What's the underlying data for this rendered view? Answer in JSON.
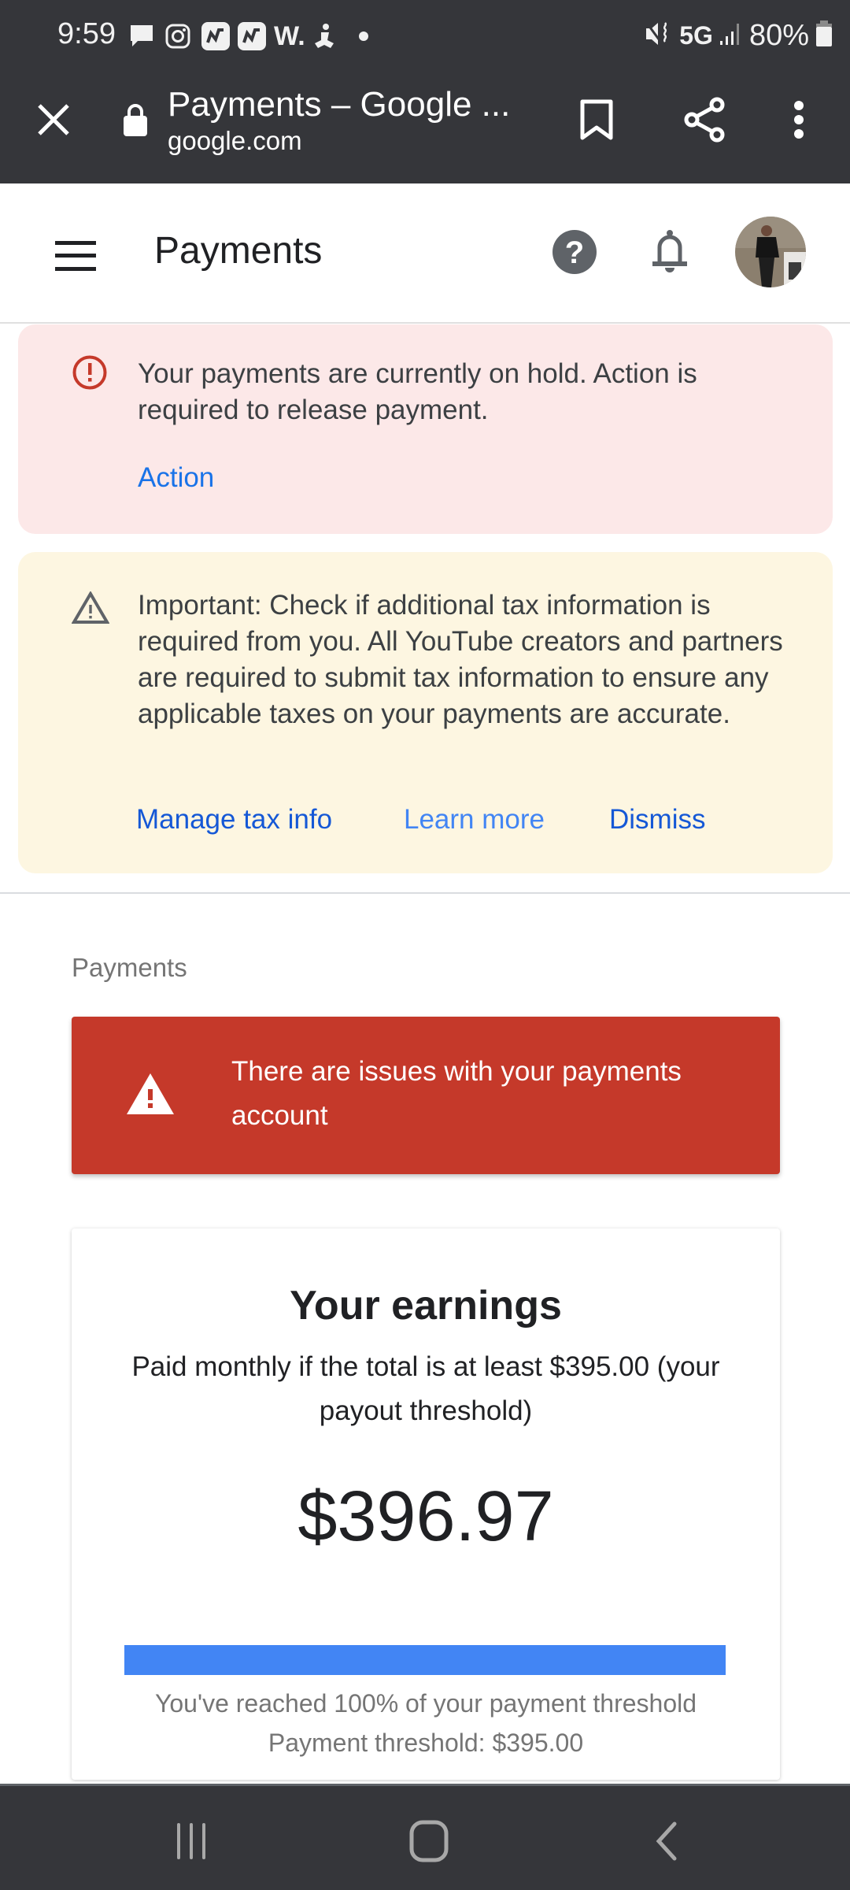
{
  "status_bar": {
    "time": "9:59",
    "notification_icons": [
      "message-icon",
      "instagram-icon",
      "app-icon",
      "app-icon",
      "w-app-icon",
      "meditation-icon",
      "more-dot-icon"
    ],
    "network": "5G",
    "battery_percent": "80%"
  },
  "browser": {
    "page_title": "Payments – Google ...",
    "domain": "google.com"
  },
  "header": {
    "title": "Payments"
  },
  "hold_banner": {
    "message": "Your payments are currently on hold. Action is required to release payment.",
    "action_label": "Action"
  },
  "tax_banner": {
    "message": "Important: Check if additional tax information is required from you. All YouTube creators and partners are required to submit tax information to ensure any applicable taxes on your payments are accurate.",
    "links": [
      "Manage tax info",
      "Learn more",
      "Dismiss"
    ]
  },
  "section": {
    "label": "Payments"
  },
  "issues_banner": {
    "message": "There are issues with your payments account"
  },
  "earnings": {
    "title": "Your earnings",
    "subtitle": "Paid monthly if the total is at least $395.00 (your payout threshold)",
    "amount": "$396.97",
    "progress_percent": 100,
    "progress_message": "You've reached 100% of your payment threshold",
    "threshold_text": "Payment threshold: $395.00"
  },
  "colors": {
    "chrome_dark": "#35363a",
    "error_red": "#c5392a",
    "hold_bg": "#fce8e8",
    "tax_bg": "#fdf6e1",
    "link_blue": "#1a73e8",
    "progress_blue": "#4285f4"
  }
}
